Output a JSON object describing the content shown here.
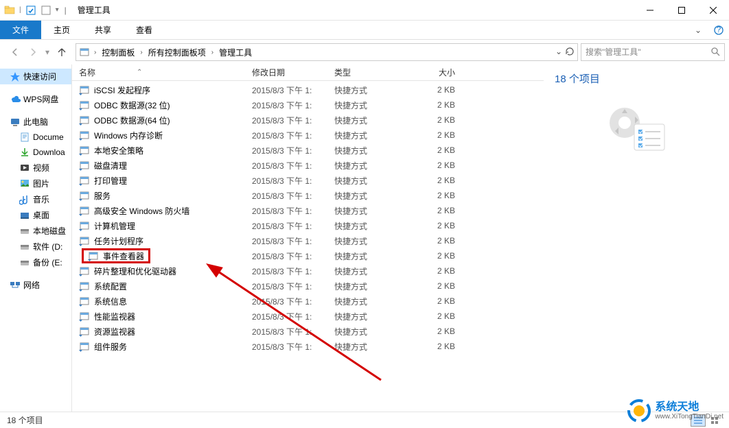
{
  "window": {
    "title": "管理工具"
  },
  "ribbon": {
    "file": "文件",
    "tabs": [
      "主页",
      "共享",
      "查看"
    ]
  },
  "breadcrumb": {
    "items": [
      "控制面板",
      "所有控制面板项",
      "管理工具"
    ]
  },
  "search": {
    "placeholder": "搜索\"管理工具\""
  },
  "sidebar": {
    "quick_access": "快速访问",
    "wps": "WPS网盘",
    "this_pc": "此电脑",
    "this_pc_children": [
      "Docume",
      "Downloa",
      "视频",
      "图片",
      "音乐",
      "桌面",
      "本地磁盘",
      "软件 (D:",
      "备份 (E:"
    ],
    "network": "网络"
  },
  "columns": {
    "name": "名称",
    "date": "修改日期",
    "type": "类型",
    "size": "大小"
  },
  "files": [
    {
      "name": "iSCSI 发起程序",
      "date": "2015/8/3 下午 1:",
      "type": "快捷方式",
      "size": "2 KB",
      "icon": "iscsi"
    },
    {
      "name": "ODBC 数据源(32 位)",
      "date": "2015/8/3 下午 1:",
      "type": "快捷方式",
      "size": "2 KB",
      "icon": "odbc"
    },
    {
      "name": "ODBC 数据源(64 位)",
      "date": "2015/8/3 下午 1:",
      "type": "快捷方式",
      "size": "2 KB",
      "icon": "odbc"
    },
    {
      "name": "Windows 内存诊断",
      "date": "2015/8/3 下午 1:",
      "type": "快捷方式",
      "size": "2 KB",
      "icon": "mem"
    },
    {
      "name": "本地安全策略",
      "date": "2015/8/3 下午 1:",
      "type": "快捷方式",
      "size": "2 KB",
      "icon": "sec"
    },
    {
      "name": "磁盘清理",
      "date": "2015/8/3 下午 1:",
      "type": "快捷方式",
      "size": "2 KB",
      "icon": "disk"
    },
    {
      "name": "打印管理",
      "date": "2015/8/3 下午 1:",
      "type": "快捷方式",
      "size": "2 KB",
      "icon": "print"
    },
    {
      "name": "服务",
      "date": "2015/8/3 下午 1:",
      "type": "快捷方式",
      "size": "2 KB",
      "icon": "gear"
    },
    {
      "name": "高级安全 Windows 防火墙",
      "date": "2015/8/3 下午 1:",
      "type": "快捷方式",
      "size": "2 KB",
      "icon": "firewall"
    },
    {
      "name": "计算机管理",
      "date": "2015/8/3 下午 1:",
      "type": "快捷方式",
      "size": "2 KB",
      "icon": "computer"
    },
    {
      "name": "任务计划程序",
      "date": "2015/8/3 下午 1:",
      "type": "快捷方式",
      "size": "2 KB",
      "icon": "task"
    },
    {
      "name": "事件查看器",
      "date": "2015/8/3 下午 1:",
      "type": "快捷方式",
      "size": "2 KB",
      "icon": "event",
      "highlight": true
    },
    {
      "name": "碎片整理和优化驱动器",
      "date": "2015/8/3 下午 1:",
      "type": "快捷方式",
      "size": "2 KB",
      "icon": "defrag"
    },
    {
      "name": "系统配置",
      "date": "2015/8/3 下午 1:",
      "type": "快捷方式",
      "size": "2 KB",
      "icon": "config"
    },
    {
      "name": "系统信息",
      "date": "2015/8/3 下午 1:",
      "type": "快捷方式",
      "size": "2 KB",
      "icon": "info"
    },
    {
      "name": "性能监视器",
      "date": "2015/8/3 下午 1:",
      "type": "快捷方式",
      "size": "2 KB",
      "icon": "perf"
    },
    {
      "name": "资源监视器",
      "date": "2015/8/3 下午 1:",
      "type": "快捷方式",
      "size": "2 KB",
      "icon": "resmon"
    },
    {
      "name": "组件服务",
      "date": "2015/8/3 下午 1:",
      "type": "快捷方式",
      "size": "2 KB",
      "icon": "comp"
    }
  ],
  "detail": {
    "count": "18 个项目"
  },
  "statusbar": {
    "left": "18 个项目"
  },
  "watermark": {
    "line1": "系统天地",
    "line2": "www.XiTongTianDi.net"
  }
}
